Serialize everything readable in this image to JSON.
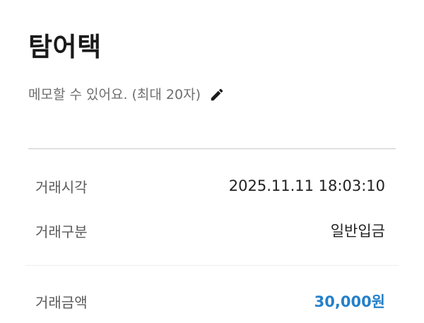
{
  "header": {
    "title": "탐어택"
  },
  "memo": {
    "placeholder": "메모할 수 있어요. (최대 20자)",
    "edit_icon": "pencil-icon"
  },
  "details": {
    "time": {
      "label": "거래시각",
      "value": "2025.11.11 18:03:10"
    },
    "type": {
      "label": "거래구분",
      "value": "일반입금"
    },
    "amount": {
      "label": "거래금액",
      "value": "30,000원"
    }
  },
  "colors": {
    "amount": "#2580c9",
    "title": "#1a1a1a",
    "memo_text": "#6f6f6f"
  }
}
